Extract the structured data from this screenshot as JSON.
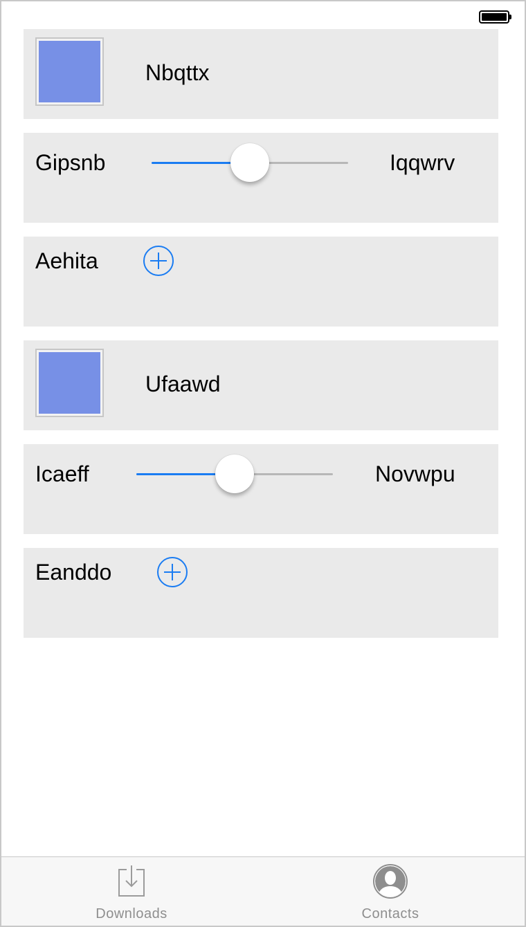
{
  "status_bar": {
    "battery_level": 1.0
  },
  "colors": {
    "accent": "#1a7cf2",
    "swatch": "#7790e6",
    "cell_background": "#eaeaea",
    "tab_inactive": "#8e8e8e"
  },
  "rows": [
    {
      "type": "swatch",
      "label": "Nbqttx"
    },
    {
      "type": "slider",
      "left_label": "Gipsnb",
      "right_label": "Iqqwrv",
      "value": 0.5
    },
    {
      "type": "add",
      "label": "Aehita"
    },
    {
      "type": "swatch",
      "label": "Ufaawd"
    },
    {
      "type": "slider",
      "left_label": "Icaeff",
      "right_label": "Novwpu",
      "value": 0.5
    },
    {
      "type": "add",
      "label": "Eanddo"
    }
  ],
  "tabbar": {
    "tabs": [
      {
        "label": "Downloads",
        "icon": "downloads-icon"
      },
      {
        "label": "Contacts",
        "icon": "contacts-icon"
      }
    ]
  }
}
